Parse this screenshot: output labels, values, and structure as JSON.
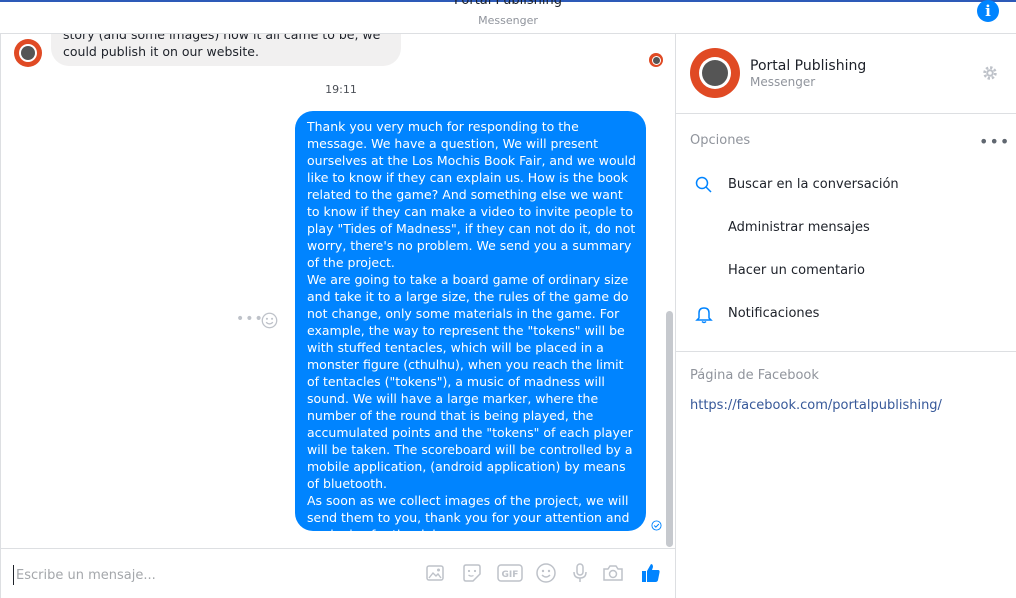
{
  "header": {
    "title": "Portal Publishing",
    "subtitle": "Messenger"
  },
  "conversation": {
    "incoming_message": "story (and some images) how it all came to be, we could publish it on our website.",
    "timestamp": "19:11",
    "outgoing_message": "Thank you very much for responding to the message. We have a question, We will present ourselves at the Los Mochis Book Fair, and we would like to know if they can explain us. How is the book related to the game? And something else we want to know if they can make a video to invite people to play \"Tides of Madness\", if they can not do it, do not worry, there's no problem. We send you a summary of the project.\nWe are going to take a board game of ordinary size and take it to a large size, the rules of the game do not change, only some materials in the game. For example, the way to represent the \"tokens\" will be with stuffed tentacles, which will be placed in a monster figure (cthulhu), when you reach the limit of tentacles (\"tokens\"), a music of madness will sound. We will have a large marker, where the number of the round that is being played, the accumulated points and the \"tokens\" of each player will be taken. The scoreboard will be controlled by a mobile application, (android application) by means of bluetooth.\nAs soon as we collect images of the project, we will send them to you, thank you for your attention and apologize for the delay."
  },
  "composer": {
    "placeholder": "Escribe un mensaje..."
  },
  "sidebar": {
    "name": "Portal Publishing",
    "subtitle": "Messenger",
    "options_title": "Opciones",
    "options": [
      {
        "label": "Buscar en la conversación",
        "icon": "search-icon"
      },
      {
        "label": "Administrar mensajes",
        "icon": ""
      },
      {
        "label": "Hacer un comentario",
        "icon": ""
      },
      {
        "label": "Notificaciones",
        "icon": "bell-icon"
      }
    ],
    "facebook_title": "Página de Facebook",
    "facebook_link": "https://facebook.com/portalpublishing/"
  },
  "colors": {
    "accent": "#0084ff",
    "brand_avatar": "#e04a24"
  }
}
